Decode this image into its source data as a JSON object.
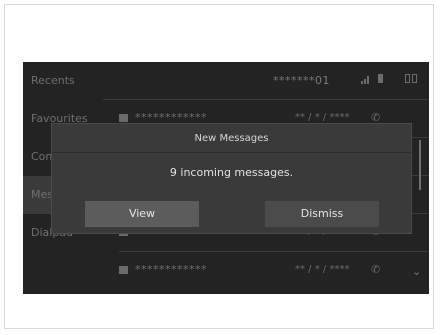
{
  "sidebar": {
    "items": [
      {
        "label": "Recents"
      },
      {
        "label": "Favourites"
      },
      {
        "label": "Contacts"
      },
      {
        "label": "Messages"
      },
      {
        "label": "Dialpad"
      }
    ]
  },
  "header": {
    "caller_id": "*******01"
  },
  "list": {
    "rows": [
      {
        "name": "************",
        "date": "** / * / ****"
      },
      {
        "name": "************",
        "date": "** / * / ****"
      },
      {
        "name": "************",
        "date": "** / * / ****"
      },
      {
        "name": "************",
        "date": "** / * / ****"
      },
      {
        "name": "************",
        "date": "** / * / ****"
      }
    ]
  },
  "dialog": {
    "title": "New Messages",
    "body": "9 incoming messages.",
    "view_label": "View",
    "dismiss_label": "Dismiss"
  },
  "icons": {
    "message": "message-icon",
    "phone": "phone-icon",
    "signal": "signal-icon",
    "battery": "battery-icon",
    "sim": "dual-sim-icon",
    "chevron": "chevron-down-icon"
  }
}
